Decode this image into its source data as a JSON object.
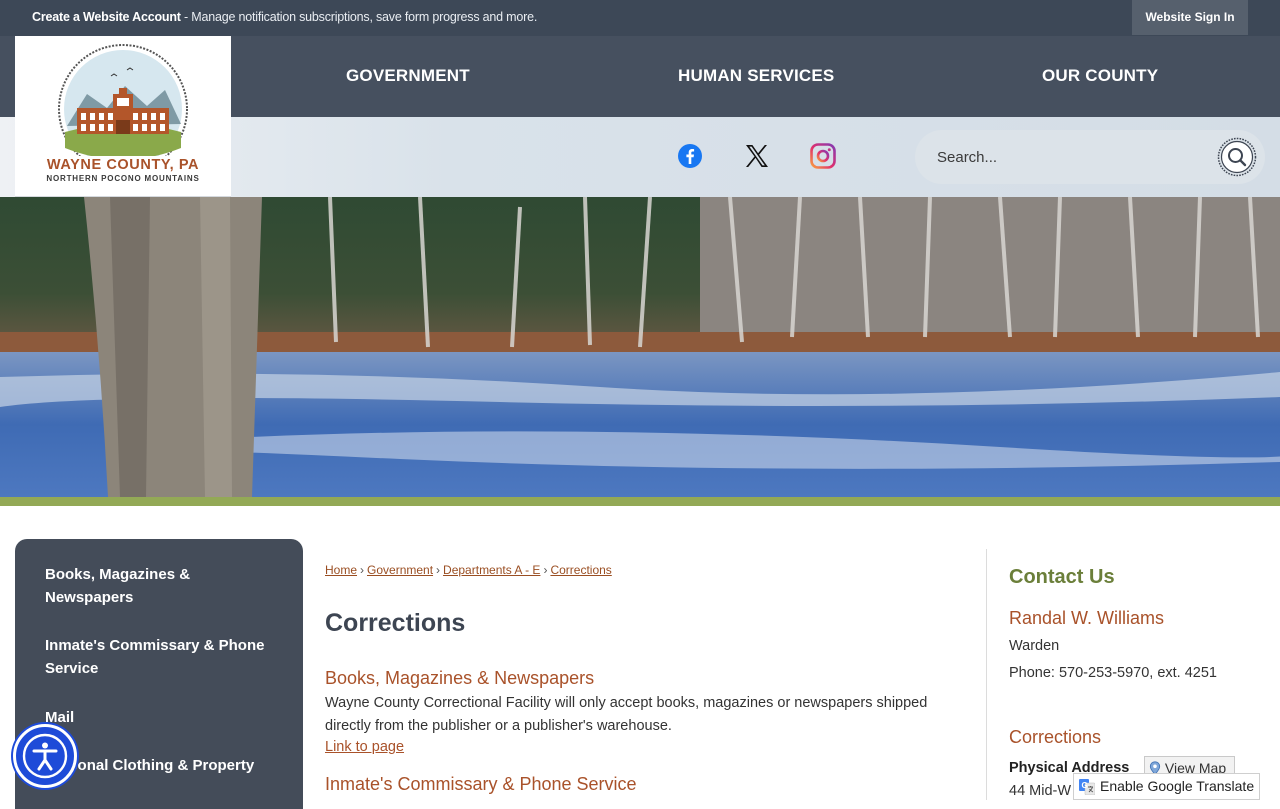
{
  "topbar": {
    "create_account": "Create a Website Account",
    "message": " - Manage notification subscriptions, save form progress and more.",
    "signin": "Website Sign In"
  },
  "nav": {
    "items": [
      "GOVERNMENT",
      "HUMAN SERVICES",
      "OUR COUNTY"
    ]
  },
  "logo": {
    "line1": "WAYNE COUNTY, PA",
    "line2": "NORTHERN POCONO MOUNTAINS"
  },
  "social": {
    "icons": [
      "facebook-icon",
      "x-icon",
      "instagram-icon"
    ]
  },
  "search": {
    "placeholder": "Search..."
  },
  "sidebar": {
    "items": [
      "Books, Magazines & Newspapers",
      "Inmate's Commissary & Phone Service",
      "Mail",
      "Personal Clothing & Property"
    ]
  },
  "breadcrumb": {
    "items": [
      "Home",
      "Government",
      "Departments A - E",
      "Corrections"
    ],
    "separator": "›"
  },
  "main": {
    "title": "Corrections",
    "sections": [
      {
        "title": "Books, Magazines & Newspapers",
        "body": "Wayne County Correctional Facility will only accept books, magazines or newspapers shipped directly from the publisher or a publisher's warehouse.",
        "link": "Link to page"
      },
      {
        "title": "Inmate's Commissary & Phone Service"
      }
    ]
  },
  "contact": {
    "title": "Contact Us",
    "name": "Randal W. Williams",
    "role": "Warden",
    "phone": "Phone: 570-253-5970, ext. 4251",
    "section": "Corrections",
    "physical_label": "Physical Address",
    "view_map": "View Map",
    "address_partial": "44 Mid-W"
  },
  "translate": {
    "label": "Enable Google Translate"
  },
  "colors": {
    "header_dark": "#3d4857",
    "nav_bg": "#46505f",
    "accent_brown": "#a9522a",
    "accent_green": "#93a956",
    "contact_green": "#6b7f3a",
    "a11y_blue": "#1e4bd8"
  }
}
